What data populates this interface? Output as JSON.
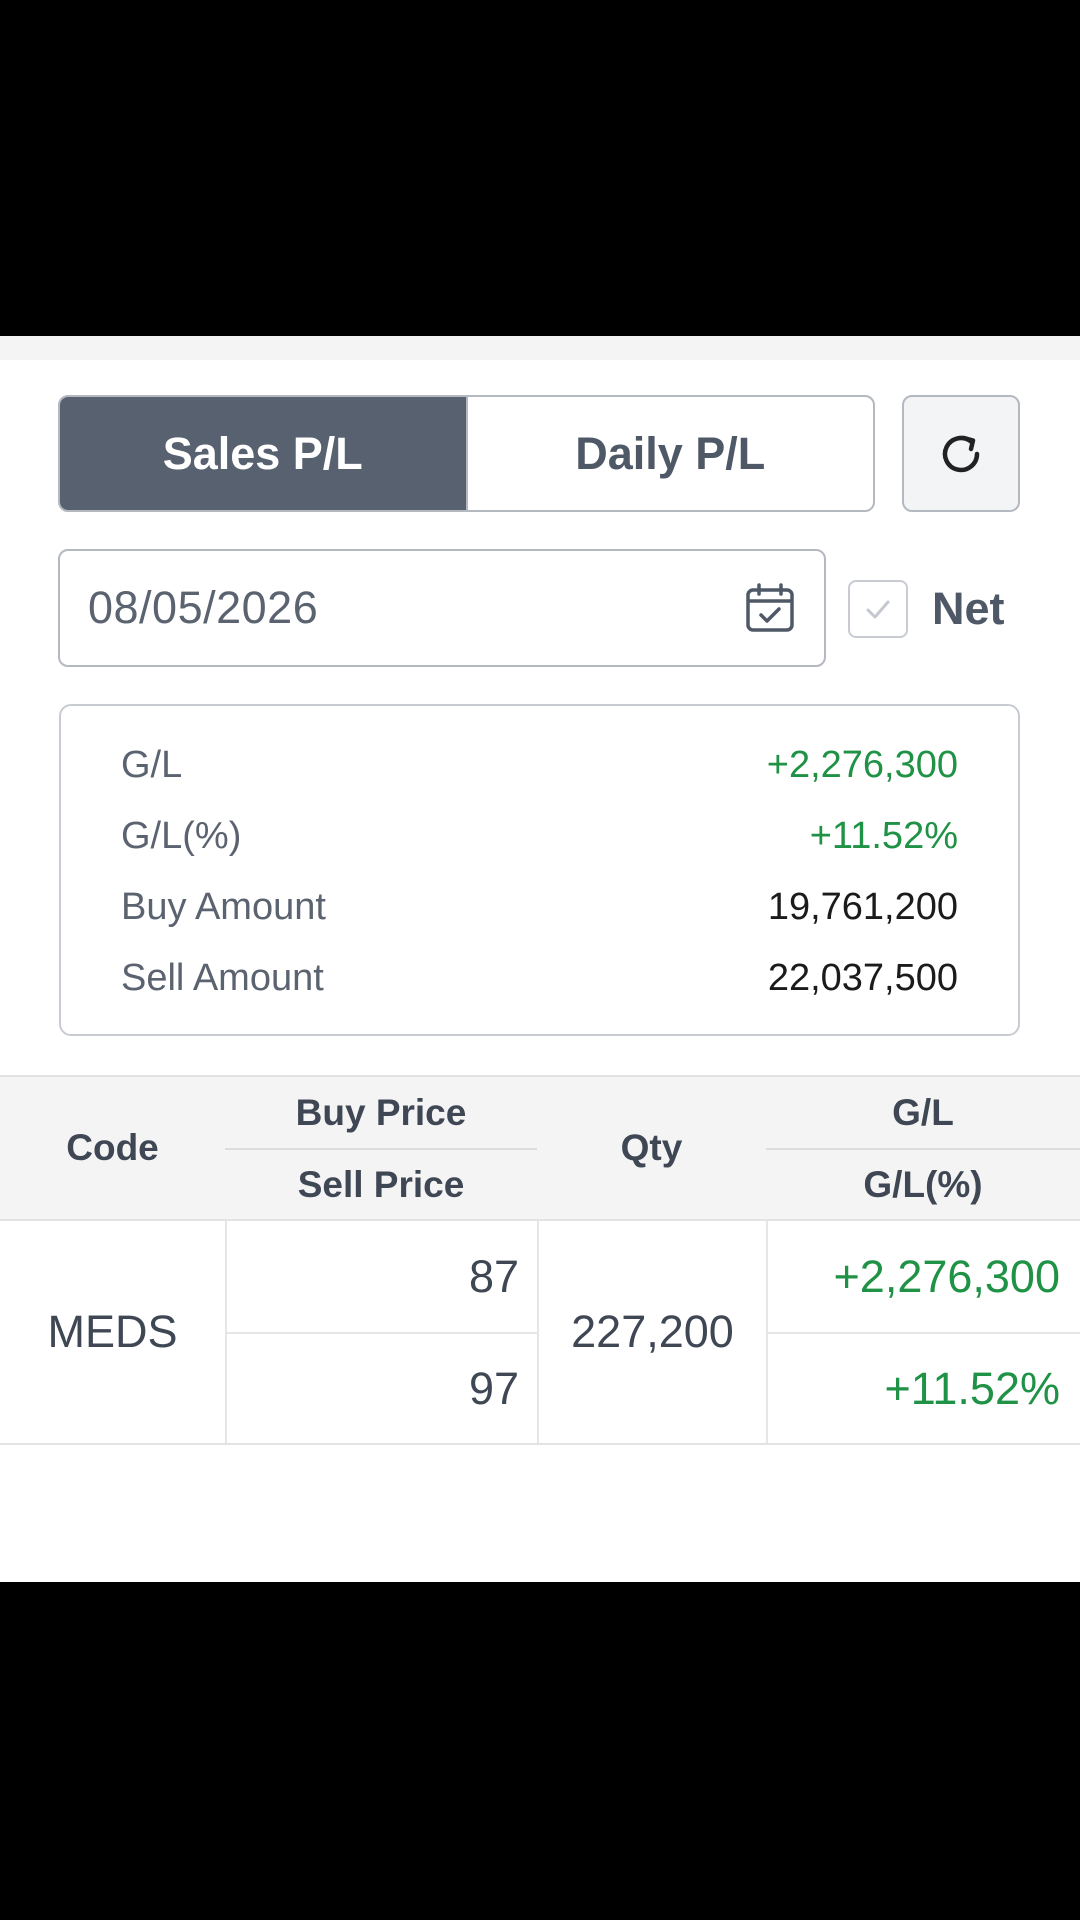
{
  "tabs": [
    {
      "label": "Sales P/L",
      "active": true
    },
    {
      "label": "Daily P/L",
      "active": false
    }
  ],
  "refresh_icon": "refresh-icon",
  "date_field": {
    "value": "08/05/2026",
    "icon": "calendar-icon"
  },
  "net_checkbox": {
    "label": "Net",
    "checked": true
  },
  "summary": [
    {
      "key": "G/L",
      "value": "+2,276,300",
      "positive": true
    },
    {
      "key": "G/L(%)",
      "value": "+11.52%",
      "positive": true
    },
    {
      "key": "Buy Amount",
      "value": "19,761,200",
      "positive": false
    },
    {
      "key": "Sell Amount",
      "value": "22,037,500",
      "positive": false
    }
  ],
  "table": {
    "headers": {
      "code": "Code",
      "buy_price": "Buy Price",
      "sell_price": "Sell Price",
      "qty": "Qty",
      "gl": "G/L",
      "gl_pct": "G/L(%)"
    },
    "rows": [
      {
        "code": "MEDS",
        "buy_price": "87",
        "sell_price": "97",
        "qty": "227,200",
        "gl": "+2,276,300",
        "gl_pct": "+11.52%"
      }
    ]
  },
  "colors": {
    "positive": "#1f9246",
    "active_tab": "#58616f"
  }
}
